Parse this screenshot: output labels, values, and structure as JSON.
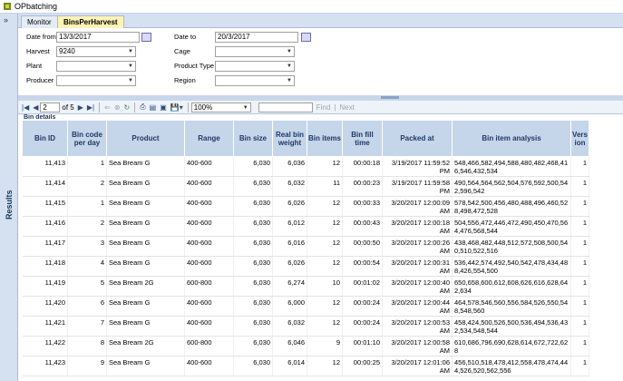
{
  "window": {
    "title": "OPbatching"
  },
  "sidebar": {
    "expand_glyph": "»",
    "results_label": "Results"
  },
  "tabs": [
    {
      "label": "Monitor"
    },
    {
      "label": "BinsPerHarvest"
    }
  ],
  "filters": {
    "date_from_label": "Date from",
    "date_from_value": "13/3/2017",
    "date_to_label": "Date to",
    "date_to_value": "20/3/2017",
    "harvest_label": "Harvest",
    "harvest_value": "9240",
    "cage_label": "Cage",
    "cage_value": "",
    "plant_label": "Plant",
    "plant_value": "",
    "product_type_label": "Product Type",
    "product_type_value": "",
    "producer_label": "Producer",
    "producer_value": "",
    "region_label": "Region",
    "region_value": ""
  },
  "toolbar": {
    "page_current": "2",
    "page_of": "of 5",
    "zoom": "100%",
    "find_label": "Find",
    "next_label": "Next",
    "sep_label": "|"
  },
  "report": {
    "section_title": "Bin details",
    "columns": [
      "Bin ID",
      "Bin code per day",
      "Product",
      "Range",
      "Bin size",
      "Real bin weight",
      "Bin items",
      "Bin fill time",
      "Packed at",
      "Bin item analysis",
      "Version"
    ],
    "rows": [
      {
        "bin_id": "11,413",
        "code": "1",
        "product": "Sea Bream G",
        "range": "400-600",
        "size": "6,030",
        "weight": "6,036",
        "items": "12",
        "fill": "00:00:18",
        "packed": "3/19/2017 11:59:52 PM",
        "analysis": "548,466,582,494,588,480,482,468,416,546,432,534",
        "version": "1"
      },
      {
        "bin_id": "11,414",
        "code": "2",
        "product": "Sea Bream G",
        "range": "400-600",
        "size": "6,030",
        "weight": "6,032",
        "items": "11",
        "fill": "00:00:23",
        "packed": "3/19/2017 11:59:58 PM",
        "analysis": "490,564,564,562,504,576,592,500,542,596,542",
        "version": "1"
      },
      {
        "bin_id": "11,415",
        "code": "1",
        "product": "Sea Bream G",
        "range": "400-600",
        "size": "6,030",
        "weight": "6,026",
        "items": "12",
        "fill": "00:00:33",
        "packed": "3/20/2017 12:00:09 AM",
        "analysis": "578,542,500,456,480,488,496,460,528,498,472,528",
        "version": "1"
      },
      {
        "bin_id": "11,416",
        "code": "2",
        "product": "Sea Bream G",
        "range": "400-600",
        "size": "6,030",
        "weight": "6,012",
        "items": "12",
        "fill": "00:00:43",
        "packed": "3/20/2017 12:00:18 AM",
        "analysis": "504,556,472,446,472,490,450,470,564,476,568,544",
        "version": "1"
      },
      {
        "bin_id": "11,417",
        "code": "3",
        "product": "Sea Bream G",
        "range": "400-600",
        "size": "6,030",
        "weight": "6,016",
        "items": "12",
        "fill": "00:00:50",
        "packed": "3/20/2017 12:00:26 AM",
        "analysis": "438,468,482,448,512,572,508,500,540,510,522,516",
        "version": "1"
      },
      {
        "bin_id": "11,418",
        "code": "4",
        "product": "Sea Bream G",
        "range": "400-600",
        "size": "6,030",
        "weight": "6,026",
        "items": "12",
        "fill": "00:00:54",
        "packed": "3/20/2017 12:00:31 AM",
        "analysis": "536,442,574,492,540,542,478,434,488,426,554,500",
        "version": "1"
      },
      {
        "bin_id": "11,419",
        "code": "5",
        "product": "Sea Bream 2G",
        "range": "600-800",
        "size": "6,030",
        "weight": "6,274",
        "items": "10",
        "fill": "00:01:02",
        "packed": "3/20/2017 12:00:40 AM",
        "analysis": "650,658,600,612,608,626,616,628,642,634",
        "version": "1"
      },
      {
        "bin_id": "11,420",
        "code": "6",
        "product": "Sea Bream G",
        "range": "400-600",
        "size": "6,030",
        "weight": "6,000",
        "items": "12",
        "fill": "00:00:24",
        "packed": "3/20/2017 12:00:44 AM",
        "analysis": "464,578,546,560,556,584,526,550,548,548,560",
        "version": "1"
      },
      {
        "bin_id": "11,421",
        "code": "7",
        "product": "Sea Bream G",
        "range": "400-600",
        "size": "6,030",
        "weight": "6,032",
        "items": "12",
        "fill": "00:00:24",
        "packed": "3/20/2017 12:00:53 AM",
        "analysis": "458,424,500,526,500,536,494,536,432,534,548,544",
        "version": "1"
      },
      {
        "bin_id": "11,422",
        "code": "8",
        "product": "Sea Bream 2G",
        "range": "600-800",
        "size": "6,030",
        "weight": "6,046",
        "items": "9",
        "fill": "00:01:10",
        "packed": "3/20/2017 12:00:58 AM",
        "analysis": "610,686,796,690,628,614,672,722,628",
        "version": "1"
      },
      {
        "bin_id": "11,423",
        "code": "9",
        "product": "Sea Bream G",
        "range": "400-600",
        "size": "6,030",
        "weight": "6,014",
        "items": "12",
        "fill": "00:00:25",
        "packed": "3/20/2017 12:01:06 AM",
        "analysis": "456,510,518,478,412,558,478,474,444,526,520,562,556",
        "version": "1"
      }
    ]
  }
}
